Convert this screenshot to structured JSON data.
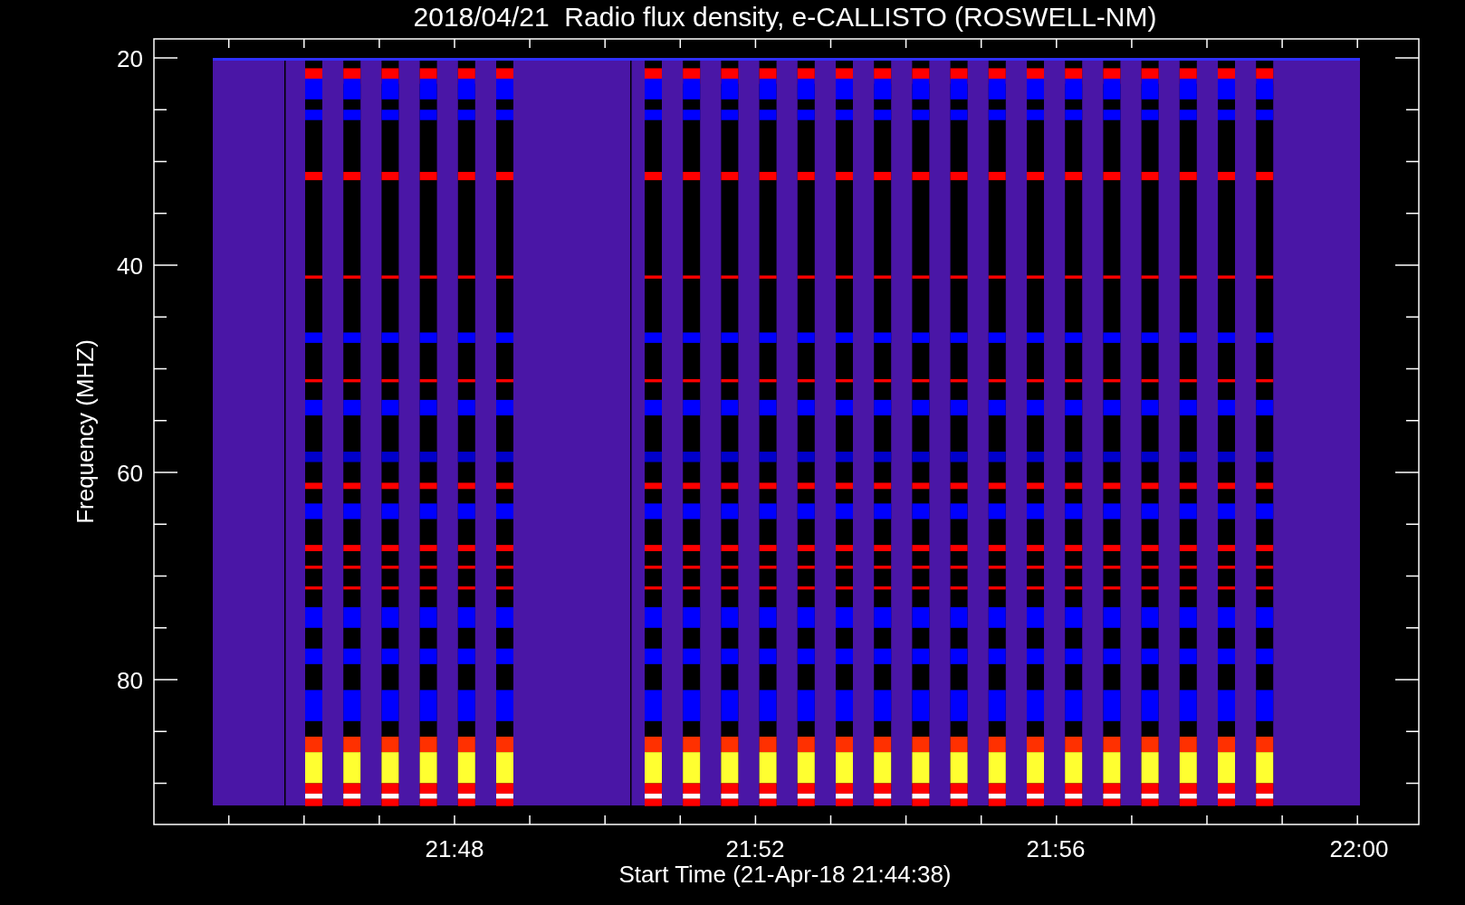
{
  "plot": {
    "title": "2018/04/21  Radio flux density, e-CALLISTO (ROSWELL-NM)",
    "xlabel": "Start Time (21-Apr-18 21:44:38)",
    "ylabel": "Frequency (MHZ)",
    "x_tick_labels": [
      "21:48",
      "21:52",
      "21:56",
      "22:00"
    ],
    "y_tick_labels": [
      "20",
      "40",
      "60",
      "80"
    ]
  }
}
